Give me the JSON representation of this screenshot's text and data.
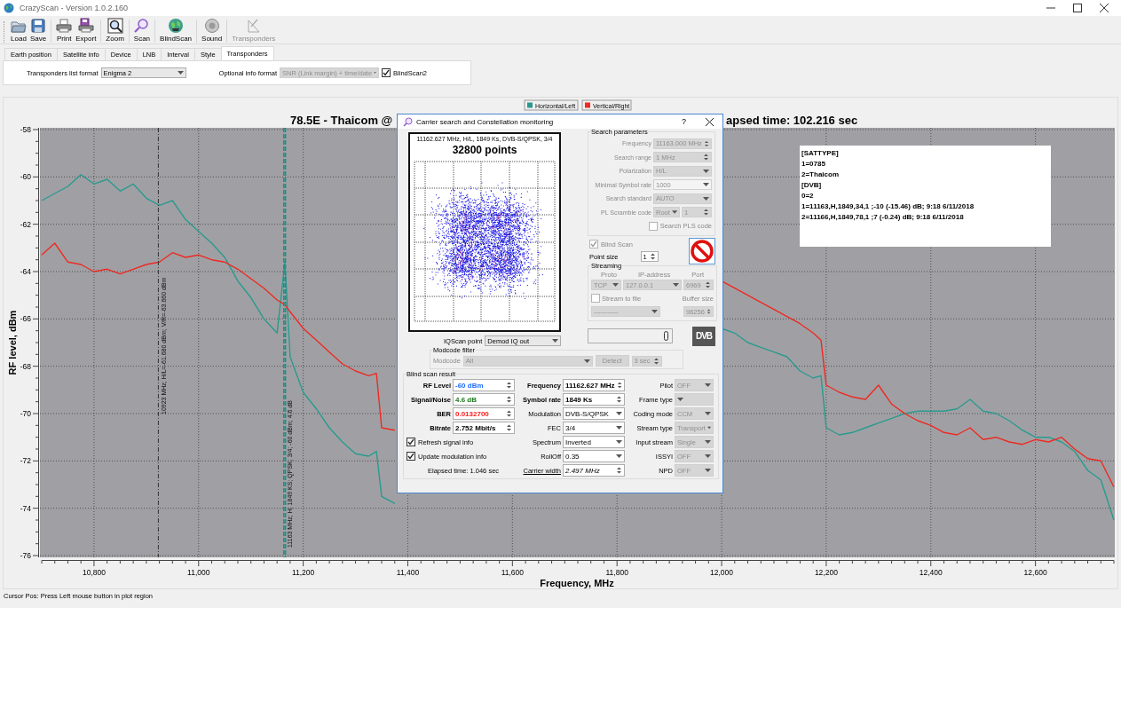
{
  "window": {
    "title": "CrazyScan - Version 1.0.2.160"
  },
  "toolbar": [
    {
      "label": "Load",
      "disabled": false,
      "separator_before": false
    },
    {
      "label": "Save",
      "disabled": false,
      "separator_before": false
    },
    {
      "label": "Print",
      "disabled": false,
      "separator_before": true
    },
    {
      "label": "Export",
      "disabled": false,
      "separator_before": false
    },
    {
      "label": "Zoom",
      "disabled": false,
      "separator_before": true
    },
    {
      "label": "Scan",
      "disabled": false,
      "separator_before": true
    },
    {
      "label": "BlindScan",
      "disabled": false,
      "separator_before": true
    },
    {
      "label": "Sound",
      "disabled": false,
      "separator_before": true
    },
    {
      "label": "Transponders",
      "disabled": true,
      "separator_before": true
    }
  ],
  "tabs": [
    {
      "label": "Earth position",
      "selected": false
    },
    {
      "label": "Satellite info",
      "selected": false
    },
    {
      "label": "Device",
      "selected": false
    },
    {
      "label": "LNB",
      "selected": false
    },
    {
      "label": "Interval",
      "selected": false
    },
    {
      "label": "Style",
      "selected": false
    },
    {
      "label": "Transponders",
      "selected": true
    }
  ],
  "tab_panel": {
    "list_format": {
      "label": "Transponders list format",
      "value": "Enigma 2"
    },
    "info_format": {
      "label": "Optional info format",
      "value": "SNR (Link margin) + time/date",
      "disabled": true
    },
    "blindscan2": {
      "label": "BlindScan2",
      "checked": true
    }
  },
  "plot": {
    "title_parts": [
      "78.5E - Thaicom @",
      "apsed time: 102.216 sec"
    ],
    "info_box": [
      "[SATTYPE]",
      "1=0785",
      "2=Thaicom",
      "[DVB]",
      "0=2",
      "1=11163,H,1849,34,1 ;-10 (-15.46) dB; 9:18 6/11/2018",
      "2=11166,H,1849,78,1 ;7 (-0.24) dB; 9:18 6/11/2018"
    ],
    "chart_data": {
      "type": "line",
      "grid": true,
      "legend": "top",
      "xlabel": "Frequency, MHz",
      "ylabel": "RF level, dBm",
      "xlim": [
        10700,
        12750
      ],
      "ylim": [
        -76,
        -58
      ],
      "xticks": [
        {
          "value": 10800,
          "label": "10,800"
        },
        {
          "value": 11000,
          "label": "11,000"
        },
        {
          "value": 11200,
          "label": "11,200"
        },
        {
          "value": 11400,
          "label": "11,400"
        },
        {
          "value": 11600,
          "label": "11,600"
        },
        {
          "value": 11800,
          "label": "11,800"
        },
        {
          "value": 12000,
          "label": "12,000"
        },
        {
          "value": 12200,
          "label": "12,200"
        },
        {
          "value": 12400,
          "label": "12,400"
        },
        {
          "value": 12600,
          "label": "12,600"
        }
      ],
      "yticks": [
        -76,
        -74,
        -72,
        -70,
        -68,
        -66,
        -64,
        -62,
        -60,
        -58
      ],
      "x": [
        10700,
        10725,
        10750,
        10775,
        10800,
        10825,
        10850,
        10875,
        10900,
        10925,
        10950,
        10975,
        11000,
        11025,
        11050,
        11075,
        11100,
        11125,
        11150,
        11165,
        11175,
        11200,
        11225,
        11250,
        11275,
        11300,
        11325,
        11340,
        11350,
        11375,
        11400,
        11425,
        11450,
        11475,
        11500,
        11525,
        11550,
        11575,
        11600,
        11625,
        11650,
        11675,
        11700,
        11725,
        11750,
        11775,
        11800,
        11825,
        11850,
        11875,
        11900,
        11925,
        11950,
        11975,
        12000,
        12025,
        12050,
        12075,
        12100,
        12125,
        12150,
        12175,
        12190,
        12200,
        12225,
        12250,
        12275,
        12300,
        12325,
        12350,
        12375,
        12400,
        12425,
        12450,
        12475,
        12500,
        12525,
        12550,
        12575,
        12600,
        12625,
        12650,
        12675,
        12700,
        12725,
        12750
      ],
      "series": [
        {
          "name": "Horizontal/Left",
          "color": "#2a9a8f",
          "values": [
            -61.0,
            -60.7,
            -60.4,
            -59.9,
            -60.3,
            -60.1,
            -60.6,
            -60.3,
            -60.9,
            -61.2,
            -61.0,
            -61.8,
            -62.3,
            -62.8,
            -63.4,
            -64.4,
            -65.1,
            -66.0,
            -66.6,
            -63.6,
            -67.6,
            -69.1,
            -69.8,
            -70.6,
            -71.2,
            -71.7,
            -71.8,
            -71.6,
            -73.5,
            -73.8,
            null,
            null,
            null,
            null,
            null,
            null,
            null,
            null,
            null,
            null,
            null,
            null,
            null,
            null,
            null,
            null,
            null,
            null,
            null,
            null,
            null,
            null,
            null,
            null,
            -66.4,
            -66.6,
            -67.0,
            -67.2,
            -67.4,
            -67.6,
            -68.2,
            -68.5,
            -68.4,
            -70.6,
            -70.9,
            -70.8,
            -70.6,
            -70.4,
            -70.2,
            -70.0,
            -69.9,
            -69.9,
            -69.9,
            -69.8,
            -69.4,
            -69.9,
            -70.0,
            -70.3,
            -70.7,
            -71.0,
            -71.0,
            -71.2,
            -71.6,
            -72.4,
            -72.8,
            -74.5
          ]
        },
        {
          "name": "Vertical/Right",
          "color": "#ee2a22",
          "values": [
            -63.3,
            -62.8,
            -63.6,
            -63.7,
            -64.0,
            -63.9,
            -64.1,
            -63.9,
            -63.7,
            -63.6,
            -63.2,
            -63.4,
            -63.3,
            -63.5,
            -63.6,
            -63.9,
            -64.3,
            -64.7,
            -65.2,
            -65.4,
            -65.7,
            -66.4,
            -66.9,
            -67.4,
            -67.9,
            -68.2,
            -68.4,
            -68.3,
            -70.6,
            -70.7,
            null,
            null,
            null,
            null,
            null,
            null,
            null,
            null,
            null,
            null,
            null,
            null,
            null,
            null,
            null,
            null,
            null,
            null,
            null,
            null,
            null,
            null,
            null,
            null,
            -64.4,
            -64.7,
            -65.0,
            -65.3,
            -65.6,
            -65.9,
            -66.2,
            -66.6,
            -66.9,
            -68.8,
            -69.1,
            -69.3,
            -69.4,
            -68.8,
            -69.6,
            -70.0,
            -70.3,
            -70.5,
            -70.8,
            -70.9,
            -70.6,
            -71.1,
            -71.0,
            -71.2,
            -71.3,
            -71.1,
            -71.2,
            -71.0,
            -71.5,
            -71.9,
            -72.0,
            -73.1
          ]
        }
      ],
      "ref_lines": [
        {
          "axis": "x",
          "value": 10923,
          "color": "#333333",
          "label": "10923 MHz;  H/L=-61.680 dBm;  V/R=-63.660 dBm"
        },
        {
          "axis": "x",
          "value": 11163,
          "color": "#1f8f86",
          "label": "11163 MHz; H; 1849 KS; QPSK; 3/4; -60 dBm; 4.6 dB"
        },
        {
          "axis": "x",
          "value": 11166,
          "color": "#1f8f86"
        }
      ]
    }
  },
  "dialog": {
    "title": "Carrier search and Constellation monitoring",
    "help": "?",
    "constellation": {
      "header": "11162.627 MHz, H/L, 1849 Ks, DVB-S/QPSK, 3/4",
      "points": "32800 points"
    },
    "iqscan": {
      "label": "IQScan point",
      "value": "Demod IQ out"
    },
    "modcode": {
      "group": "Modcode filter",
      "label": "Modcode",
      "value": "All",
      "detect": "Detect",
      "time": "3 sec",
      "disabled": true
    },
    "search": {
      "group": "Search parameters",
      "disabled": true,
      "rows": [
        {
          "kind": "spin",
          "label": "Frequency",
          "value": "11163.000 MHz"
        },
        {
          "kind": "spin",
          "label": "Search range",
          "value": "1 MHz"
        },
        {
          "kind": "dropdown",
          "label": "Polarization",
          "value": "H/L"
        },
        {
          "kind": "combo",
          "label": "Minimal Symbol rate",
          "value": "1000"
        },
        {
          "kind": "dropdown",
          "label": "Search standard",
          "value": "AUTO"
        },
        {
          "kind": "dual",
          "label": "PL Scramble code",
          "value": "Root",
          "value2": "1"
        }
      ],
      "pls": {
        "label": "Search PLS code",
        "checked": false
      }
    },
    "blind_scan": {
      "label": "Blind Scan",
      "checked": true,
      "disabled": true
    },
    "point_size": {
      "label": "Point size",
      "value": "1"
    },
    "streaming": {
      "group": "Streaming",
      "disabled": true,
      "headers": [
        "Proto",
        "IP-address",
        "Port"
      ],
      "proto": "TCP",
      "ip": "127.0.0.1",
      "port": "6969",
      "stream_to_file": {
        "label": "Stream to file",
        "checked": false
      },
      "buffer_label": "Buffer size",
      "file": "-----------",
      "buffer": "96256"
    },
    "logo": "DVB",
    "result": {
      "group": "Blind scan result",
      "left": [
        {
          "label": "RF Level",
          "value": "-60 dBm",
          "color": "#1e6cff"
        },
        {
          "label": "Signal/Noise",
          "value": "4.6 dB",
          "color": "#1d7a1d"
        },
        {
          "label": "BER",
          "value": "0.0132700",
          "color": "#ff1a1a"
        },
        {
          "label": "Bitrate",
          "value": "2.752 Mbit/s",
          "color": "#000000"
        }
      ],
      "checks": [
        {
          "label": "Refresh signal info",
          "checked": true
        },
        {
          "label": "Update modulation info",
          "checked": true
        }
      ],
      "elapsed": "Elapsed time: 1.046 sec",
      "middle": [
        {
          "kind": "spin",
          "label": "Frequency",
          "value": "11162.627 MHz",
          "bold": true
        },
        {
          "kind": "spin",
          "label": "Symbol rate",
          "value": "1849 Ks",
          "bold": true
        },
        {
          "kind": "dropdown",
          "label": "Modulation",
          "value": "DVB-S/QPSK",
          "bold": false
        },
        {
          "kind": "dropdown",
          "label": "FEC",
          "value": "3/4",
          "bold": false
        },
        {
          "kind": "dropdown",
          "label": "Spectrum",
          "value": "Inverted",
          "bold": false
        },
        {
          "kind": "dropdown",
          "label": "RollOff",
          "value": "0.35",
          "bold": false
        },
        {
          "kind": "link-spin",
          "label": "Carrier width",
          "value": "2.497 MHz",
          "bold": false
        }
      ],
      "right": [
        {
          "label": "Pilot",
          "value": "OFF",
          "disabled": true
        },
        {
          "label": "Frame type",
          "disabled": true
        },
        {
          "label": "Coding mode",
          "value": "CCM",
          "disabled": true
        },
        {
          "label": "Stream type",
          "value": "Transport",
          "disabled": true
        },
        {
          "label": "Input stream",
          "value": "Single",
          "disabled": true
        },
        {
          "label": "ISSYI",
          "value": "OFF",
          "disabled": true
        },
        {
          "label": "NPD",
          "value": "OFF",
          "disabled": true
        }
      ]
    }
  },
  "status_bar": "Cursor Pos: Press Left mouse button in plot region"
}
